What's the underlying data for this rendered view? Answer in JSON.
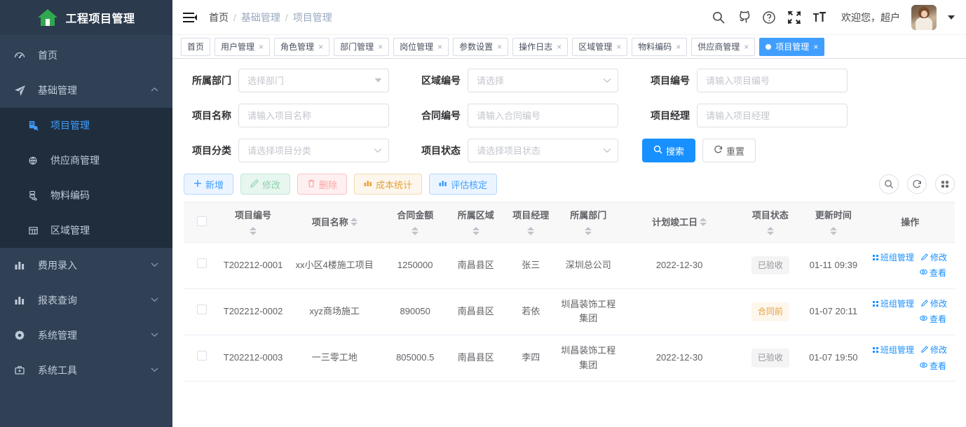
{
  "sidebar": {
    "logo_title": "工程项目管理",
    "items": [
      {
        "label": "首页",
        "icon": "dashboard-icon",
        "has_arrow": false,
        "expanded": false
      },
      {
        "label": "基础管理",
        "icon": "paper-plane-icon",
        "has_arrow": true,
        "expanded": true
      },
      {
        "label": "费用录入",
        "icon": "bar-chart-icon",
        "has_arrow": true,
        "expanded": false
      },
      {
        "label": "报表查询",
        "icon": "bar-chart-icon",
        "has_arrow": true,
        "expanded": false
      },
      {
        "label": "系统管理",
        "icon": "gear-icon",
        "has_arrow": true,
        "expanded": false
      },
      {
        "label": "系统工具",
        "icon": "toolbox-icon",
        "has_arrow": true,
        "expanded": false
      }
    ],
    "submenu": [
      {
        "label": "项目管理",
        "icon": "project-icon",
        "active": true
      },
      {
        "label": "供应商管理",
        "icon": "supplier-icon",
        "active": false
      },
      {
        "label": "物料编码",
        "icon": "material-icon",
        "active": false
      },
      {
        "label": "区域管理",
        "icon": "table-icon",
        "active": false
      }
    ]
  },
  "navbar": {
    "hamburger": "collapse-menu-icon",
    "breadcrumb": [
      "首页",
      "基础管理",
      "项目管理"
    ],
    "breadcrumb_sep": "/",
    "icons": [
      "search-icon",
      "github-icon",
      "help-circle-icon",
      "fullscreen-icon",
      "font-size-icon"
    ],
    "welcome": "欢迎您，超户",
    "avatar": "user-avatar"
  },
  "tags": [
    {
      "label": "首页",
      "closable": false,
      "active": false
    },
    {
      "label": "用户管理",
      "closable": true,
      "active": false
    },
    {
      "label": "角色管理",
      "closable": true,
      "active": false
    },
    {
      "label": "部门管理",
      "closable": true,
      "active": false
    },
    {
      "label": "岗位管理",
      "closable": true,
      "active": false
    },
    {
      "label": "参数设置",
      "closable": true,
      "active": false
    },
    {
      "label": "操作日志",
      "closable": true,
      "active": false
    },
    {
      "label": "区域管理",
      "closable": true,
      "active": false
    },
    {
      "label": "物料编码",
      "closable": true,
      "active": false
    },
    {
      "label": "供应商管理",
      "closable": true,
      "active": false
    },
    {
      "label": "项目管理",
      "closable": true,
      "active": true
    }
  ],
  "tag_close_glyph": "×",
  "search_form": {
    "fields": [
      {
        "label": "所属部门",
        "placeholder": "选择部门",
        "value": "",
        "type": "select"
      },
      {
        "label": "区域编号",
        "placeholder": "请选择",
        "value": "",
        "type": "select"
      },
      {
        "label": "项目编号",
        "placeholder": "请输入项目编号",
        "value": "",
        "type": "text"
      },
      {
        "label": "项目名称",
        "placeholder": "请输入项目名称",
        "value": "",
        "type": "text"
      },
      {
        "label": "合同编号",
        "placeholder": "请输入合同编号",
        "value": "",
        "type": "text"
      },
      {
        "label": "项目经理",
        "placeholder": "请输入项目经理",
        "value": "",
        "type": "text"
      },
      {
        "label": "项目分类",
        "placeholder": "请选择项目分类",
        "value": "",
        "type": "select"
      },
      {
        "label": "项目状态",
        "placeholder": "请选择项目状态",
        "value": "",
        "type": "select"
      }
    ],
    "search_button": "搜索",
    "reset_button": "重置"
  },
  "toolbar": {
    "buttons": [
      {
        "label": "新增",
        "icon": "plus-icon",
        "style": "add"
      },
      {
        "label": "修改",
        "icon": "pencil-icon",
        "style": "edit"
      },
      {
        "label": "删除",
        "icon": "trash-icon",
        "style": "del"
      },
      {
        "label": "成本统计",
        "icon": "chart-icon",
        "style": "cost"
      },
      {
        "label": "评估核定",
        "icon": "chart-icon",
        "style": "assess"
      }
    ],
    "right_icons": [
      "search-icon",
      "refresh-icon",
      "columns-icon"
    ]
  },
  "table": {
    "columns": [
      {
        "label": "",
        "sortable": false,
        "key": "check"
      },
      {
        "label": "项目编号",
        "sortable": true,
        "key": "code"
      },
      {
        "label": "项目名称",
        "sortable": true,
        "key": "name"
      },
      {
        "label": "合同金额",
        "sortable": true,
        "key": "amount"
      },
      {
        "label": "所属区域",
        "sortable": true,
        "key": "area"
      },
      {
        "label": "项目经理",
        "sortable": true,
        "key": "manager"
      },
      {
        "label": "所属部门",
        "sortable": true,
        "key": "dept"
      },
      {
        "label": "计划竣工日",
        "sortable": true,
        "key": "due"
      },
      {
        "label": "项目状态",
        "sortable": true,
        "key": "status"
      },
      {
        "label": "更新时间",
        "sortable": true,
        "key": "updated"
      },
      {
        "label": "操作",
        "sortable": false,
        "key": "ops"
      }
    ],
    "rows": [
      {
        "code": "T202212-0001",
        "name": "xx小区4楼施工项目",
        "amount": "1250000",
        "area": "南昌县区",
        "manager": "张三",
        "dept": "深圳总公司",
        "due": "2022-12-30",
        "status": "已验收",
        "status_style": "gray",
        "updated": "01-11 09:39",
        "ops": [
          "班组管理",
          "修改",
          "查看"
        ]
      },
      {
        "code": "T202212-0002",
        "name": "xyz商场施工",
        "amount": "890050",
        "area": "南昌县区",
        "manager": "若依",
        "dept": "圳昌装饰工程集团",
        "due": "",
        "status": "合同前",
        "status_style": "warn",
        "updated": "01-07 20:11",
        "ops": [
          "班组管理",
          "修改",
          "查看"
        ]
      },
      {
        "code": "T202212-0003",
        "name": "一三零工地",
        "amount": "805000.5",
        "area": "南昌县区",
        "manager": "李四",
        "dept": "圳昌装饰工程集团",
        "due": "2022-12-30",
        "status": "已验收",
        "status_style": "gray",
        "updated": "01-07 19:50",
        "ops": [
          "班组管理",
          "修改",
          "查看"
        ]
      }
    ]
  },
  "colors": {
    "sidebar_bg": "#304156",
    "submenu_bg": "#1f2d3d",
    "accent": "#409eff",
    "primary_button": "#1890ff",
    "logo_green": "#2fa84f",
    "warn": "#e6a23c"
  }
}
